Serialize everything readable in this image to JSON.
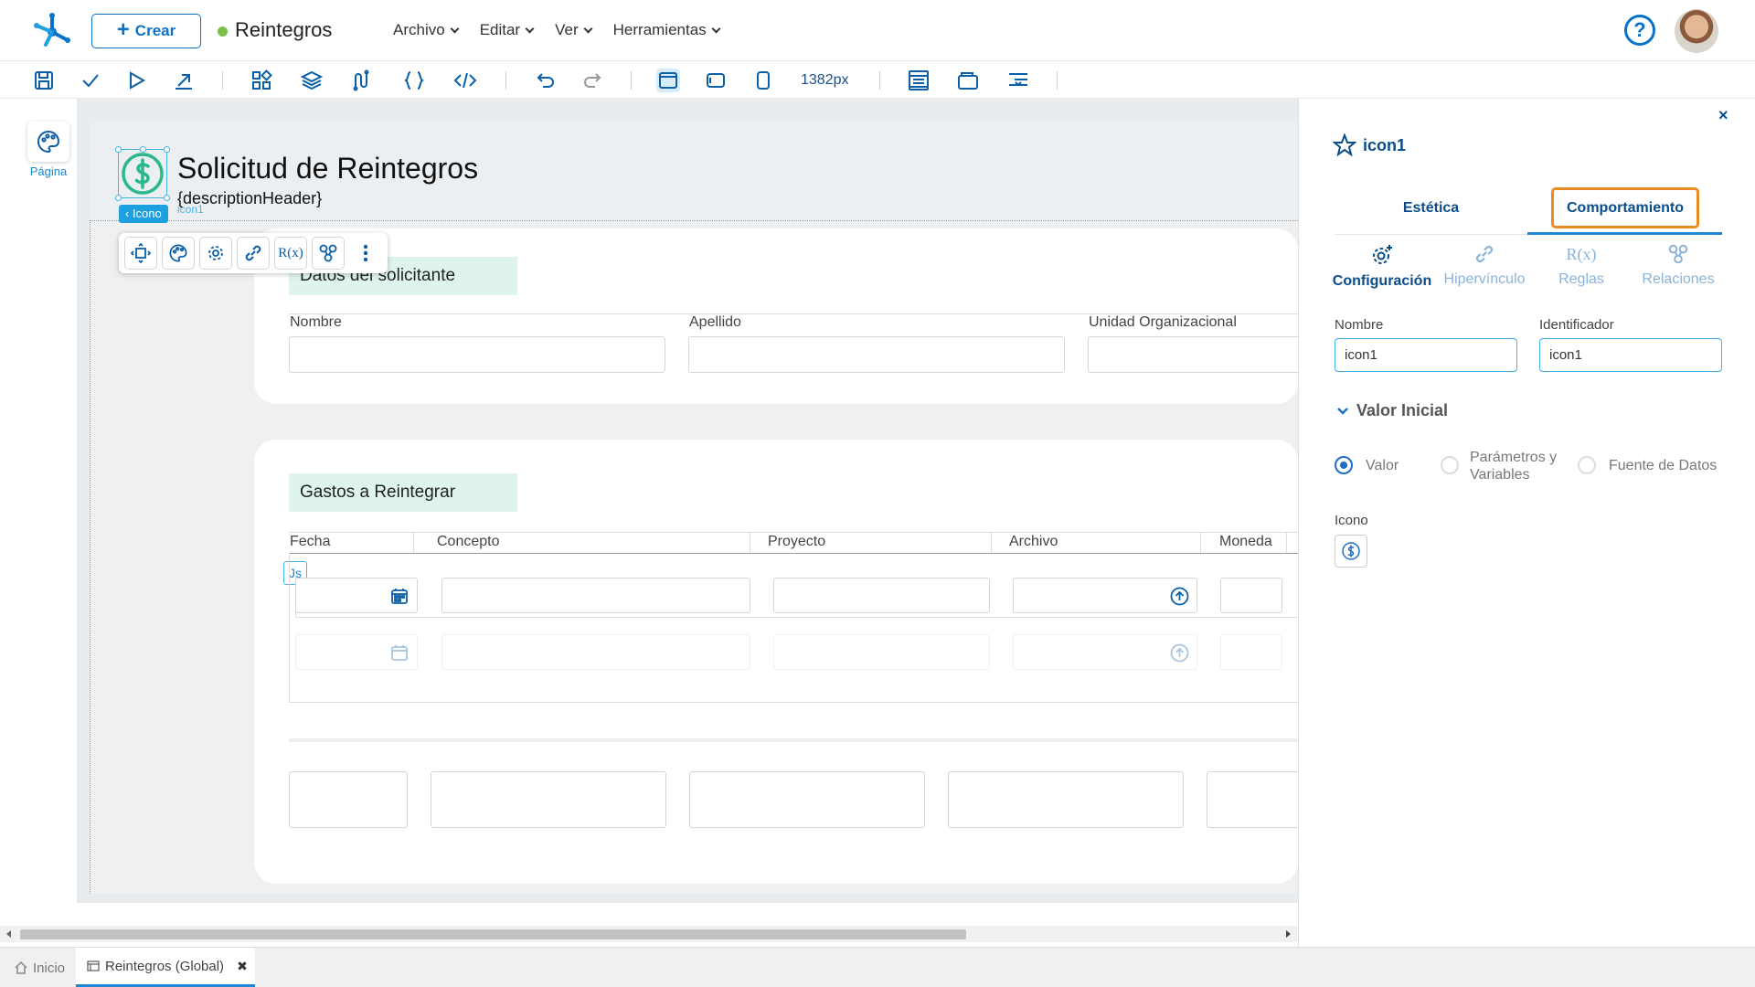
{
  "app": {
    "title": "Reintegros",
    "create_label": "Crear",
    "menu": [
      "Archivo",
      "Editar",
      "Ver",
      "Herramientas"
    ],
    "help_label": "?"
  },
  "toolbar": {
    "width_readout": "1382px"
  },
  "left_rail": {
    "page_label": "Página"
  },
  "canvas": {
    "page_title": "Solicitud de Reintegros",
    "page_subtitle": "{descriptionHeader}",
    "selected_tag": "‹ Icono",
    "selected_name": "icon1",
    "ctx_rules_glyph": "R(x)",
    "js_badge": "Js",
    "section1": {
      "title": "Datos del solicitante",
      "fields": [
        "Nombre",
        "Apellido",
        "Unidad Organizacional"
      ]
    },
    "section2": {
      "title": "Gastos a Reintegrar",
      "columns": [
        "Fecha",
        "Concepto",
        "Proyecto",
        "Archivo",
        "Moneda"
      ]
    }
  },
  "bottom_tabs": {
    "home": "Inicio",
    "current": "Reintegros (Global)",
    "close": "✖"
  },
  "panel": {
    "close": "×",
    "title": "icon1",
    "tabs": [
      "Estética",
      "Comportamiento"
    ],
    "sub_tabs": [
      "Configuración",
      "Hipervínculo",
      "Reglas",
      "Relaciones"
    ],
    "rules_glyph": "R(x)",
    "name_label": "Nombre",
    "name_value": "icon1",
    "id_label": "Identificador",
    "id_value": "icon1",
    "initial_value_label": "Valor Inicial",
    "radio_options": [
      "Valor",
      "Parámetros y Variables",
      "Fuente de Datos"
    ],
    "radio_selected": "Valor",
    "icon_label": "Icono",
    "icon_value": "dollar-circle-icon"
  },
  "colors": {
    "brand": "#0a72c9",
    "accent": "#1e88d3",
    "highlight": "#e88d24",
    "icon_green": "#2bb88a"
  }
}
